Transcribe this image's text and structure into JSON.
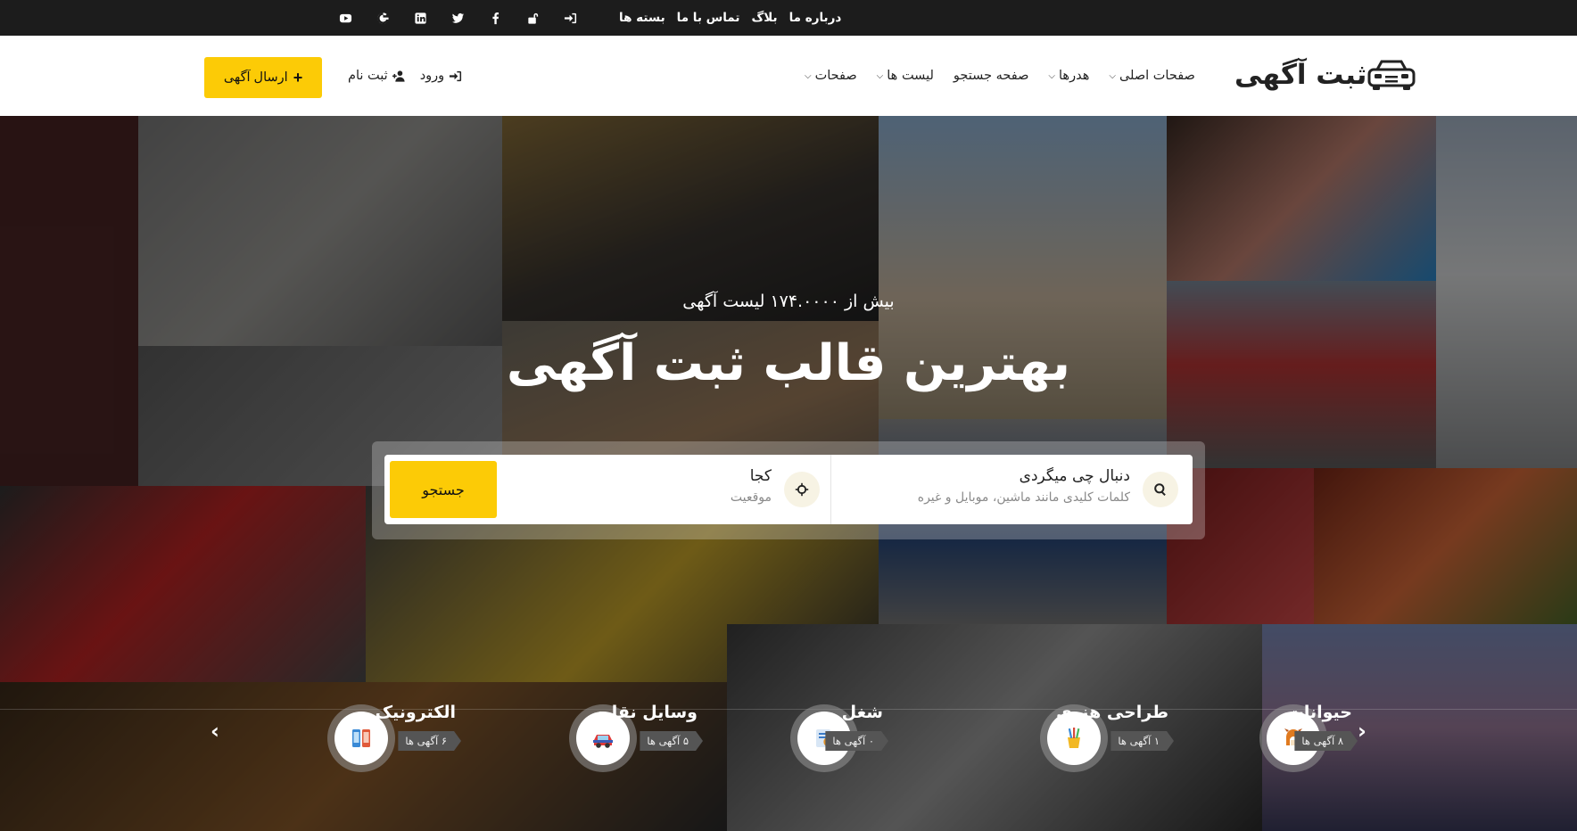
{
  "topbar": {
    "links": [
      "درباره ما",
      "بلاگ",
      "تماس با ما",
      "بسته ها"
    ],
    "social_icons": [
      "login-icon",
      "unlock-icon",
      "facebook-icon",
      "twitter-icon",
      "linkedin-icon",
      "google-icon",
      "youtube-icon"
    ]
  },
  "header": {
    "logo_text": "ثبت آگهی",
    "nav": [
      {
        "label": "صفحات اصلی",
        "has_dropdown": true
      },
      {
        "label": "هدرها",
        "has_dropdown": true
      },
      {
        "label": "صفحه جستجو",
        "has_dropdown": false
      },
      {
        "label": "لیست ها",
        "has_dropdown": true
      },
      {
        "label": "صفحات",
        "has_dropdown": true
      }
    ],
    "register_label": "ثبت نام",
    "login_label": "ورود",
    "post_ad_label": "ارسال آگهی"
  },
  "hero": {
    "subtitle": "بیش از ۱۷۴.۰۰۰۰ لیست آگهی",
    "title": "بهترین قالب ثبت آگهی"
  },
  "search": {
    "what_label": "دنبال چی میگردی",
    "what_placeholder": "کلمات کلیدی مانند ماشین، موبایل و غیره",
    "where_label": "کجا",
    "where_placeholder": "موقعیت",
    "button_label": "جستجو"
  },
  "categories": [
    {
      "name": "حیوانات",
      "count": "۸ آگهی ها",
      "icon": "pet-icon"
    },
    {
      "name": "طراحی هنری",
      "count": "۱ آگهی ها",
      "icon": "art-icon"
    },
    {
      "name": "شغل",
      "count": "۰ آگهی ها",
      "icon": "job-icon"
    },
    {
      "name": "وسایل نقلیه",
      "count": "۵ آگهی ها",
      "icon": "car-icon"
    },
    {
      "name": "الکترونیک",
      "count": "۶ آگهی ها",
      "icon": "electronics-icon"
    }
  ],
  "colors": {
    "accent": "#fccb06",
    "topbar_bg": "#1c1c1c"
  }
}
